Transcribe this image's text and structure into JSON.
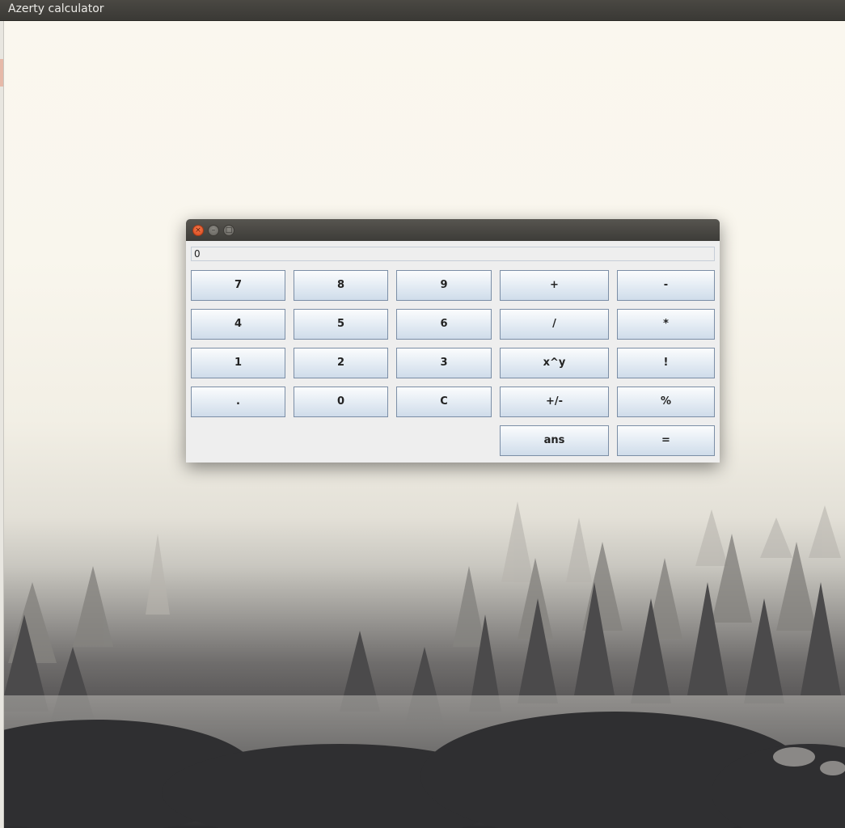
{
  "topbar": {
    "title": "Azerty calculator"
  },
  "window": {
    "controls": {
      "close": "×",
      "minimize": "–",
      "maximize": "□"
    },
    "display_value": "0",
    "keys": {
      "seven": "7",
      "eight": "8",
      "nine": "9",
      "plus": "+",
      "minus": "-",
      "four": "4",
      "five": "5",
      "six": "6",
      "divide": "/",
      "multiply": "*",
      "one": "1",
      "two": "2",
      "three": "3",
      "power": "x^y",
      "factorial": "!",
      "dot": ".",
      "zero": "0",
      "clear": "C",
      "negate": "+/-",
      "percent": "%",
      "ans": "ans",
      "equals": "="
    }
  },
  "colors": {
    "close_button": "#e2552b",
    "titlebar": "#4a4843",
    "button_border": "#7b8ea6",
    "button_gradient_bottom": "#cfdcea"
  }
}
